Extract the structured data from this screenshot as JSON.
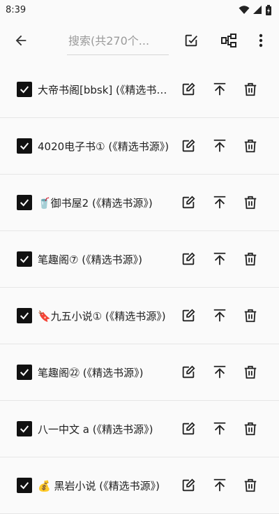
{
  "status_bar": {
    "time": "8:39"
  },
  "toolbar": {
    "search_placeholder": "搜索(共270个..."
  },
  "sources": [
    {
      "label": "大帝书阁[bbsk] (《精选书源》)",
      "checked": true
    },
    {
      "label": "4020电子书① (《精选书源》)",
      "checked": true
    },
    {
      "label": "🥤御书屋2 (《精选书源》)",
      "checked": true
    },
    {
      "label": "笔趣阁⑦ (《精选书源》)",
      "checked": true
    },
    {
      "label": "🔖九五小说① (《精选书源》)",
      "checked": true
    },
    {
      "label": "笔趣阁㉒ (《精选书源》)",
      "checked": true
    },
    {
      "label": "八一中文 a (《精选书源》)",
      "checked": true
    },
    {
      "label": "💰 黑岩小说 (《精选书源》)",
      "checked": true
    }
  ],
  "icons": {
    "back": "arrow-back-icon",
    "select_all": "select-all-icon",
    "group": "group-icon",
    "more": "more-vert-icon",
    "edit": "edit-icon",
    "to_top": "to-top-icon",
    "delete": "delete-icon",
    "check": "check-icon"
  },
  "colors": {
    "background": "#fafafa",
    "checkbox": "#111111",
    "divider": "#e6e6e6"
  }
}
